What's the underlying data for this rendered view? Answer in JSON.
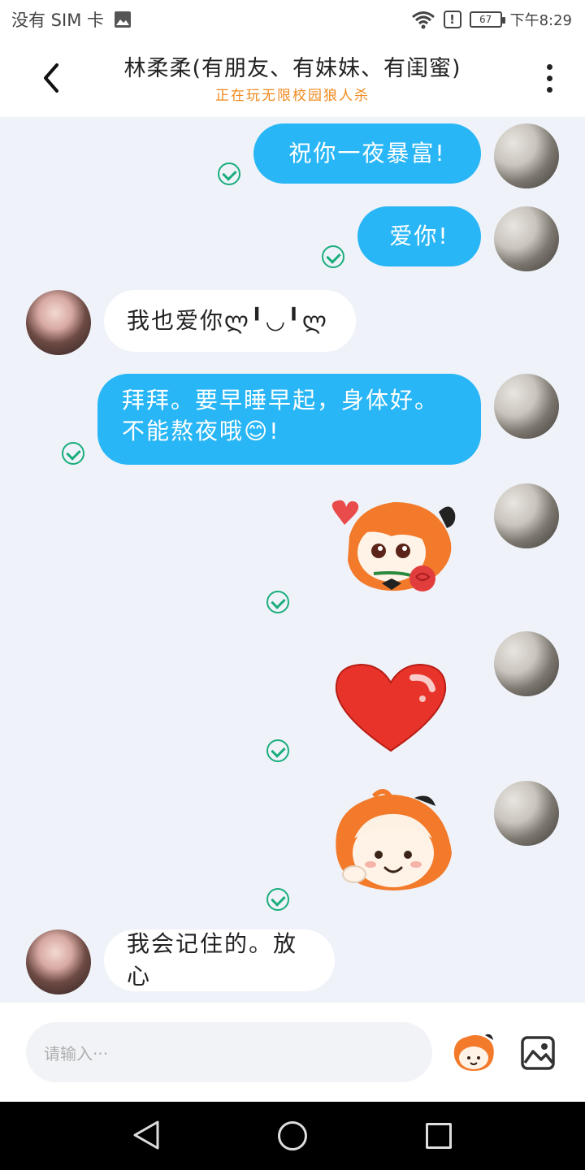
{
  "status_bar": {
    "carrier": "没有 SIM 卡",
    "battery": "67",
    "time": "下午8:29"
  },
  "header": {
    "title": "林柔柔(有朋友、有妹妹、有闺蜜)",
    "subtitle": "正在玩无限校园狼人杀"
  },
  "messages": [
    {
      "from": "me",
      "text": "祝你一夜暴富!"
    },
    {
      "from": "me",
      "text": "爱你!"
    },
    {
      "from": "them",
      "text": "我也爱你ლ╹◡╹ლ"
    },
    {
      "from": "me",
      "lines": [
        "拜拜。要早睡早起，身体好。",
        "不能熬夜哦😊!"
      ]
    },
    {
      "from": "me",
      "sticker": "rose-girl-sticker"
    },
    {
      "from": "me",
      "sticker": "red-heart-sticker"
    },
    {
      "from": "me",
      "sticker": "smiling-girl-sticker"
    },
    {
      "from": "them",
      "text": "我会记住的。放心"
    }
  ],
  "input": {
    "placeholder": "请输入···"
  },
  "colors": {
    "bubble_out": "#29b6f6",
    "check": "#1aad7c",
    "subtitle": "#f08a1e"
  }
}
